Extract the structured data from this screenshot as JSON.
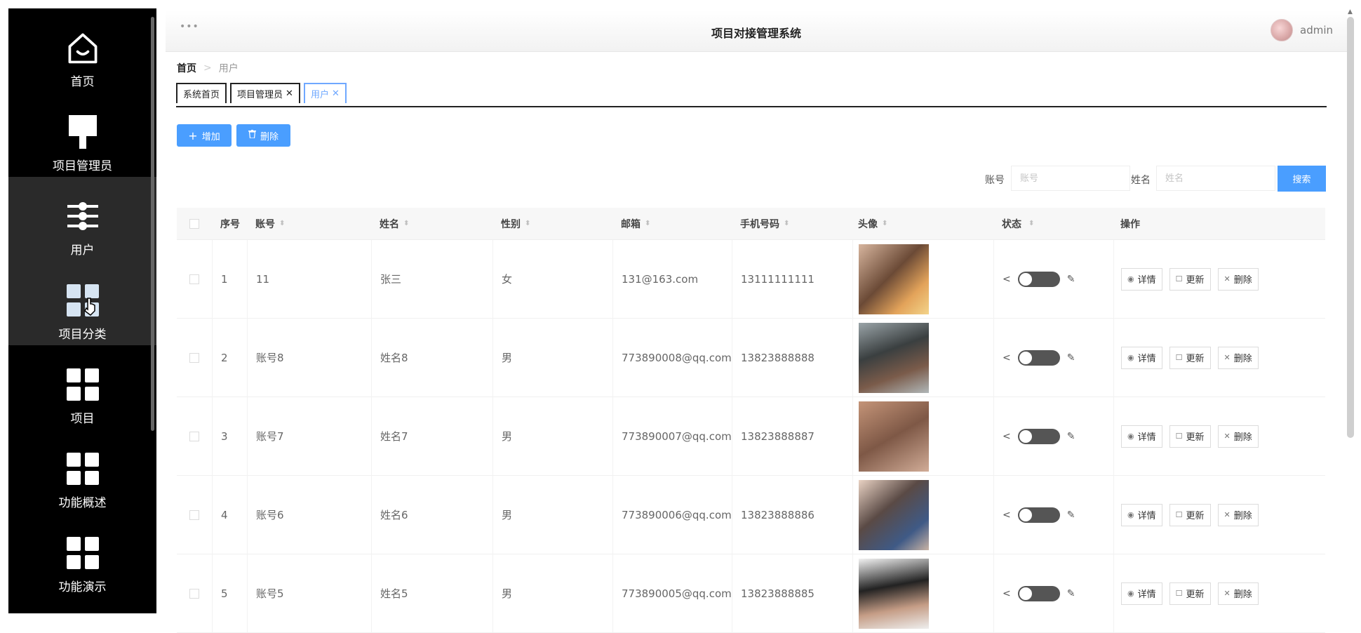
{
  "app": {
    "title": "项目对接管理系统",
    "menu_dots": "•••",
    "user": "admin"
  },
  "sidebar": {
    "items": [
      {
        "label": "首页",
        "icon": "home-icon"
      },
      {
        "label": "项目管理员",
        "icon": "brush-icon"
      },
      {
        "label": "用户",
        "icon": "sliders-icon",
        "active": true
      },
      {
        "label": "项目分类",
        "icon": "grid-icon"
      },
      {
        "label": "项目",
        "icon": "grid-icon"
      },
      {
        "label": "功能概述",
        "icon": "grid-icon"
      },
      {
        "label": "功能演示",
        "icon": "grid-icon"
      }
    ]
  },
  "breadcrumb": {
    "home": "首页",
    "sep": ">",
    "current": "用户"
  },
  "tabs": [
    {
      "label": "系统首页",
      "closable": false
    },
    {
      "label": "项目管理员",
      "closable": true
    },
    {
      "label": "用户",
      "closable": true,
      "active": true
    }
  ],
  "toolbar": {
    "add_label": "增加",
    "add_icon": "plus-icon",
    "delete_label": "删除",
    "delete_icon": "trash-icon"
  },
  "search": {
    "account_label": "账号",
    "account_placeholder": "账号",
    "name_label": "姓名",
    "name_placeholder": "姓名",
    "button_label": "搜索"
  },
  "table": {
    "columns": [
      "序号",
      "账号",
      "姓名",
      "性别",
      "邮箱",
      "手机号码",
      "头像",
      "状态",
      "操作"
    ],
    "rows": [
      {
        "idx": "1",
        "account": "11",
        "name": "张三",
        "sex": "女",
        "email": "131@163.com",
        "phone": "13111111111"
      },
      {
        "idx": "2",
        "account": "账号8",
        "name": "姓名8",
        "sex": "男",
        "email": "773890008@qq.com",
        "phone": "13823888888"
      },
      {
        "idx": "3",
        "account": "账号7",
        "name": "姓名7",
        "sex": "男",
        "email": "773890007@qq.com",
        "phone": "13823888887"
      },
      {
        "idx": "4",
        "account": "账号6",
        "name": "姓名6",
        "sex": "男",
        "email": "773890006@qq.com",
        "phone": "13823888886"
      },
      {
        "idx": "5",
        "account": "账号5",
        "name": "姓名5",
        "sex": "男",
        "email": "773890005@qq.com",
        "phone": "13823888885"
      }
    ],
    "ops": {
      "detail": "详情",
      "update": "更新",
      "delete": "删除"
    }
  },
  "colors": {
    "sidebar_bg": "#000000",
    "accent": "#4a9eff",
    "active_tab": "#6fa8ff"
  }
}
